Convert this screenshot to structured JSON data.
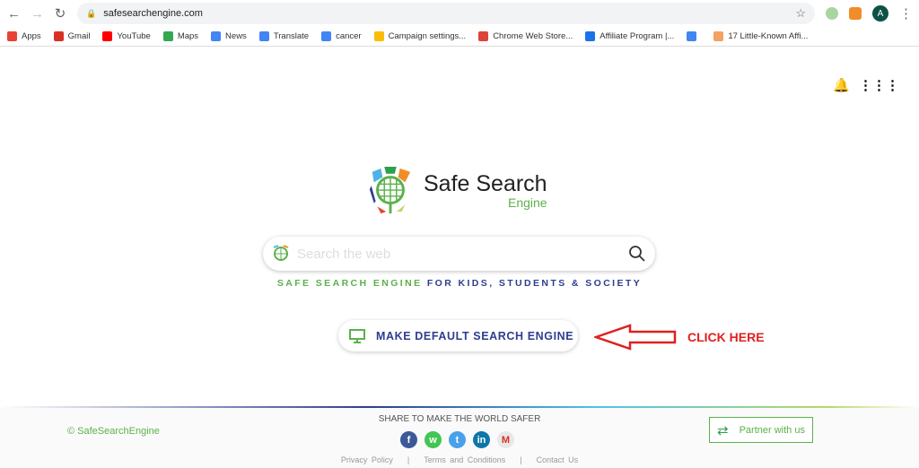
{
  "browser": {
    "url": "safesearchengine.com",
    "avatar": "A",
    "bookmarks": [
      {
        "label": "Apps",
        "color": "#e94235"
      },
      {
        "label": "Gmail",
        "color": "#d93025"
      },
      {
        "label": "YouTube",
        "color": "#ff0000"
      },
      {
        "label": "Maps",
        "color": "#34a853"
      },
      {
        "label": "News",
        "color": "#4285f4"
      },
      {
        "label": "Translate",
        "color": "#4285f4"
      },
      {
        "label": "cancer",
        "color": "#4285f4"
      },
      {
        "label": "Campaign settings...",
        "color": "#fbbc04"
      },
      {
        "label": "Chrome Web Store...",
        "color": "#db4437"
      },
      {
        "label": "Affiliate Program |...",
        "color": "#1a73e8"
      },
      {
        "label": "",
        "color": "#4285f4"
      },
      {
        "label": "17 Little-Known Affi...",
        "color": "#f4a261"
      }
    ]
  },
  "brand": {
    "line1": "Safe Search",
    "line2": "Engine"
  },
  "search": {
    "placeholder": "Search the web"
  },
  "tagline": {
    "green": "SAFE SEARCH ENGINE",
    "blue": "FOR KIDS, STUDENTS & SOCIETY"
  },
  "make_default": "MAKE DEFAULT SEARCH ENGINE",
  "click_here": "CLICK HERE",
  "footer": {
    "copyright": "© SafeSearchEngine",
    "share": "SHARE TO MAKE THE WORLD SAFER",
    "social": [
      {
        "name": "facebook",
        "glyph": "f",
        "color": "#3b5998"
      },
      {
        "name": "whatsapp",
        "glyph": "w",
        "color": "#43c553"
      },
      {
        "name": "twitter",
        "glyph": "t",
        "color": "#4aa1eb"
      },
      {
        "name": "linkedin",
        "glyph": "in",
        "color": "#0e76a8"
      },
      {
        "name": "gmail",
        "glyph": "M",
        "color": "#e8e8e8"
      }
    ],
    "links": [
      "Privacy Policy",
      "Terms and Conditions",
      "Contact Us"
    ],
    "partner": "Partner with us"
  },
  "colors": {
    "green": "#5bb14a",
    "blue": "#2e3d8e",
    "red": "#e02020"
  }
}
